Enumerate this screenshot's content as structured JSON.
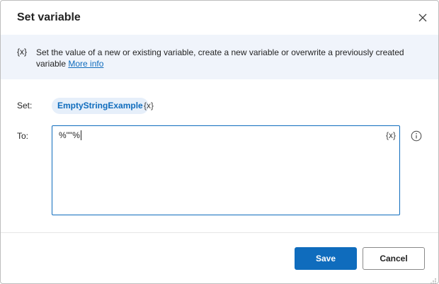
{
  "dialog": {
    "title": "Set variable",
    "close_icon": "close-icon"
  },
  "info": {
    "var_icon_text": "{x}",
    "description": "Set the value of a new or existing variable, create a new variable or overwrite a previously created variable",
    "link_text": "More info"
  },
  "form": {
    "set_label": "Set:",
    "variable_name": "EmptyStringExample",
    "set_var_picker": "{x}",
    "to_label": "To:",
    "to_value": "%\"\"%",
    "to_var_picker": "{x}",
    "help_icon": "info-circle-icon"
  },
  "footer": {
    "save_label": "Save",
    "cancel_label": "Cancel"
  },
  "colors": {
    "accent": "#0f6cbd",
    "info_band": "#f0f4fb",
    "chip_bg": "#e6effa"
  }
}
